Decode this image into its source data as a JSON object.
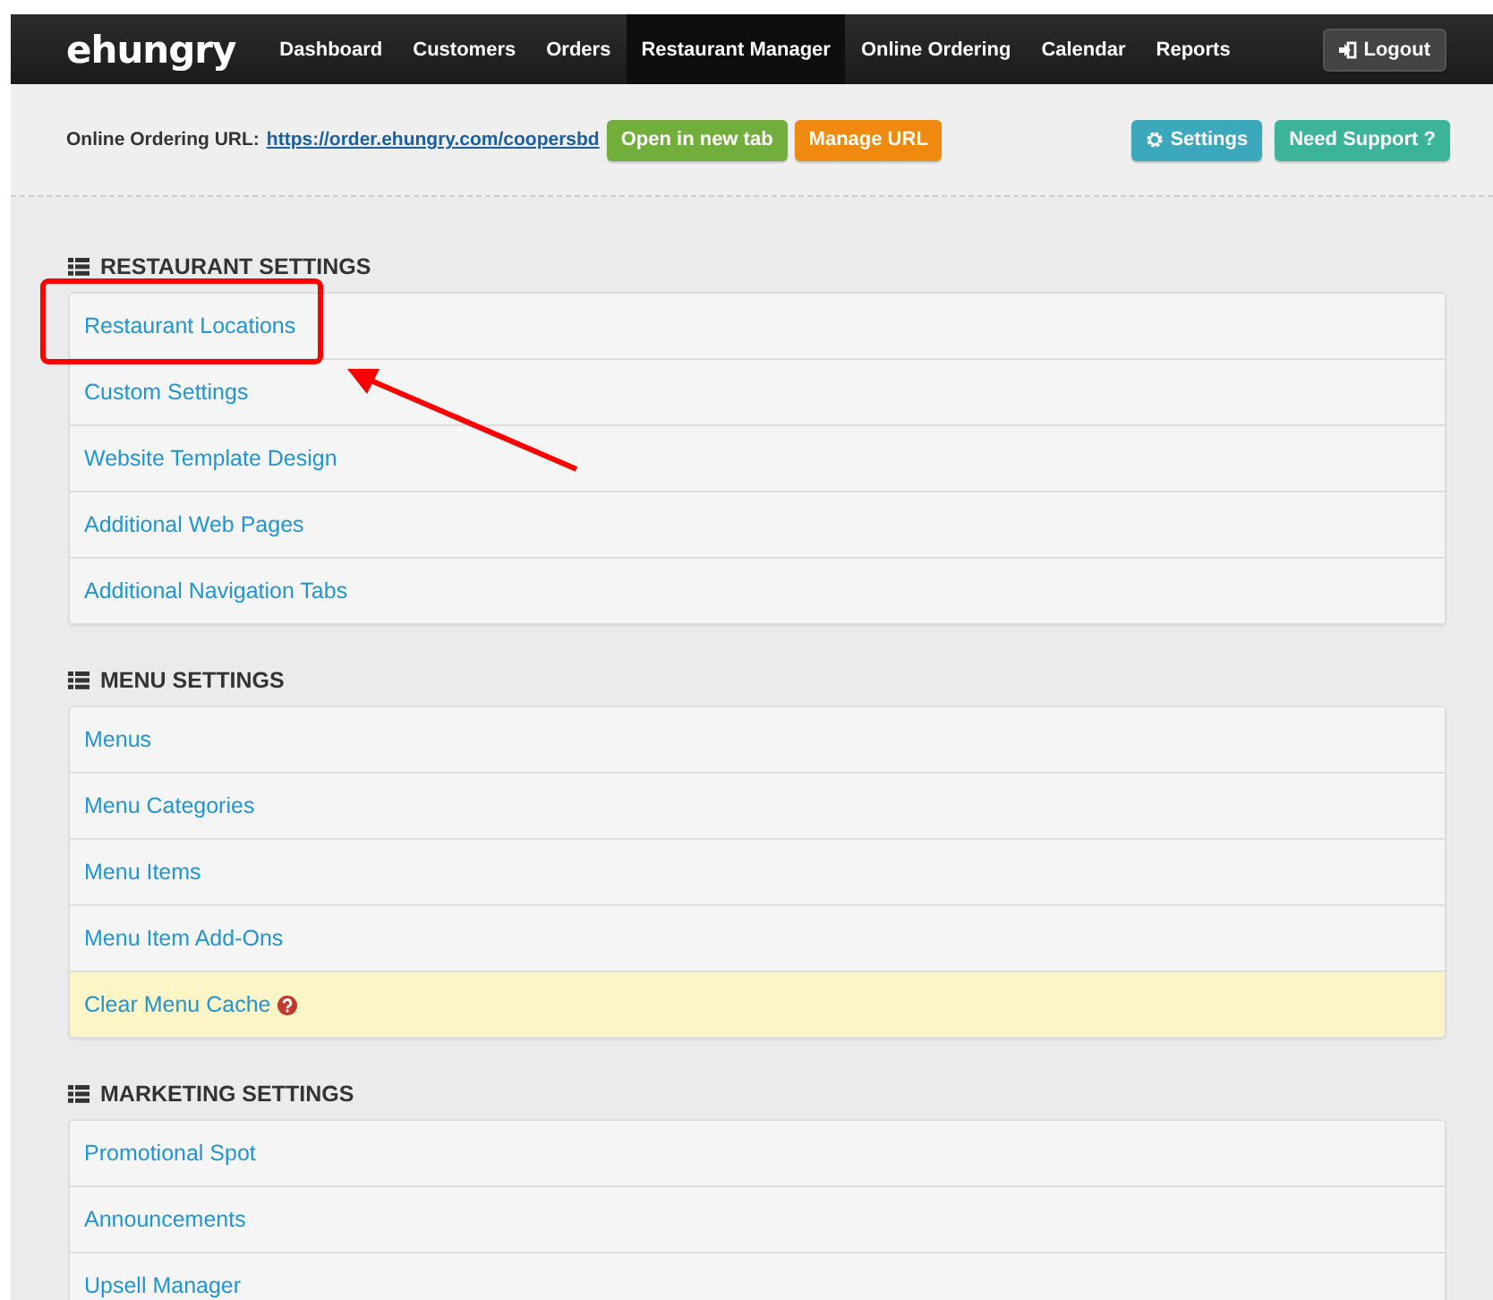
{
  "brand": {
    "logo": "ehungry"
  },
  "nav": {
    "items": [
      {
        "label": "Dashboard",
        "selected": false
      },
      {
        "label": "Customers",
        "selected": false
      },
      {
        "label": "Orders",
        "selected": false
      },
      {
        "label": "Restaurant Manager",
        "selected": true
      },
      {
        "label": "Online Ordering",
        "selected": false
      },
      {
        "label": "Calendar",
        "selected": false
      },
      {
        "label": "Reports",
        "selected": false
      }
    ],
    "logout": "Logout"
  },
  "toolbar": {
    "url_label": "Online Ordering URL:",
    "url": "https://order.ehungry.com/coopersbd",
    "buttons": [
      {
        "label": "Open in new tab",
        "kind": "success"
      },
      {
        "label": "Manage URL",
        "kind": "warning"
      }
    ],
    "right_buttons": [
      {
        "label": "Settings",
        "kind": "info"
      },
      {
        "label": "Need Support ?",
        "kind": "teal"
      }
    ]
  },
  "sections": [
    {
      "title": "RESTAURANT SETTINGS",
      "items": [
        {
          "label": "Restaurant Locations",
          "highlighted": false
        },
        {
          "label": "Custom Settings",
          "highlighted": false
        },
        {
          "label": "Website Template Design",
          "highlighted": false
        },
        {
          "label": "Additional Web Pages",
          "highlighted": false
        },
        {
          "label": "Additional Navigation Tabs",
          "highlighted": false
        }
      ]
    },
    {
      "title": "MENU SETTINGS",
      "items": [
        {
          "label": "Menus",
          "highlighted": false
        },
        {
          "label": "Menu Categories",
          "highlighted": false
        },
        {
          "label": "Menu Items",
          "highlighted": false
        },
        {
          "label": "Menu Item Add-Ons",
          "highlighted": false
        },
        {
          "label": "Clear Menu Cache",
          "highlighted": true,
          "help": true
        }
      ]
    },
    {
      "title": "MARKETING SETTINGS",
      "items": [
        {
          "label": "Promotional Spot",
          "highlighted": false
        },
        {
          "label": "Announcements",
          "highlighted": false
        },
        {
          "label": "Upsell Manager",
          "highlighted": false
        }
      ]
    }
  ]
}
